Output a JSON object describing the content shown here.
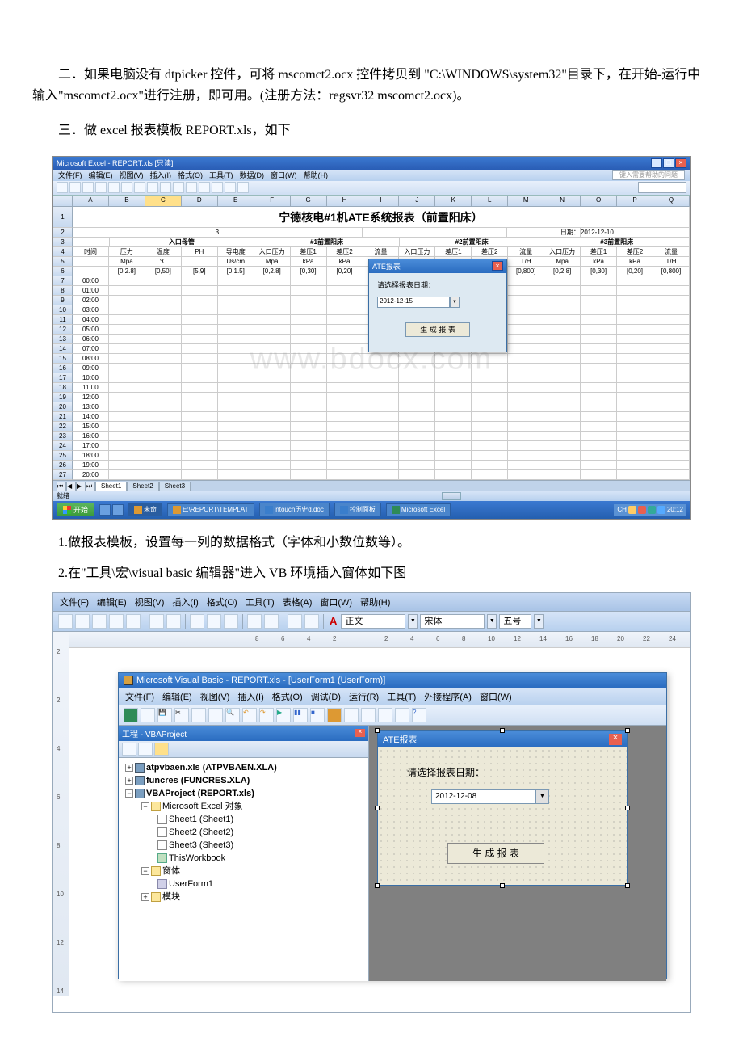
{
  "doc": {
    "para2": "二．如果电脑没有 dtpicker 控件，可将 mscomct2.ocx 控件拷贝到 \"C:\\WINDOWS\\system32\"目录下，在开始-运行中输入\"mscomct2.ocx\"进行注册，即可用。(注册方法：regsvr32 mscomct2.ocx)。",
    "para3": "三．做 excel 报表模板 REPORT.xls，如下",
    "note1": "1.做报表模板，设置每一列的数据格式（字体和小数位数等）。",
    "note2": "2.在\"工具\\宏\\visual basic 编辑器\"进入 VB 环境插入窗体如下图",
    "watermark": "www.bdocx.com"
  },
  "excel": {
    "title": "Microsoft Excel - REPORT.xls  [只读]",
    "menus": [
      "文件(F)",
      "编辑(E)",
      "视图(V)",
      "插入(I)",
      "格式(O)",
      "工具(T)",
      "数据(D)",
      "窗口(W)",
      "帮助(H)"
    ],
    "help_hint": "键入需要帮助的问题",
    "cols": [
      "A",
      "B",
      "C",
      "D",
      "E",
      "F",
      "G",
      "H",
      "I",
      "J",
      "K",
      "L",
      "M",
      "N",
      "O",
      "P",
      "Q"
    ],
    "report_title": "宁德核电#1机ATE系统报表（前置阳床）",
    "date_lbl": "日期：",
    "date_val": "2012-12-10",
    "groups": {
      "g0": "入口母管",
      "g1": "#1前置阳床",
      "g2": "#2前置阳床",
      "g3": "#3前置阳床"
    },
    "row4": [
      "时间",
      "压力",
      "温度",
      "PH",
      "导电度",
      "入口压力",
      "差压1",
      "差压2",
      "流量",
      "入口压力",
      "差压1",
      "差压2",
      "流量",
      "入口压力",
      "差压1",
      "差压2",
      "流量"
    ],
    "row5": [
      "",
      "Mpa",
      "℃",
      "",
      "Us/cm",
      "Mpa",
      "kPa",
      "kPa",
      "T/H",
      "Mpa",
      "kPa",
      "kPa",
      "T/H",
      "Mpa",
      "kPa",
      "kPa",
      "T/H"
    ],
    "row6": [
      "",
      "[0,2.8]",
      "[0,50]",
      "[5,9]",
      "[0,1.5]",
      "[0,2.8]",
      "[0,30]",
      "[0,20]",
      "[0,800]",
      "[0,2.8]",
      "[0,30]",
      "[0,20]",
      "[0,800]",
      "[0,2.8]",
      "[0,30]",
      "[0,20]",
      "[0,800]"
    ],
    "times": [
      "00:00",
      "01:00",
      "02:00",
      "03:00",
      "04:00",
      "05:00",
      "06:00",
      "07:00",
      "08:00",
      "09:00",
      "10:00",
      "11:00",
      "12:00",
      "13:00",
      "14:00",
      "15:00",
      "16:00",
      "17:00",
      "18:00",
      "19:00",
      "20:00"
    ],
    "popup": {
      "title": "ATE报表",
      "label": "请选择报表日期：",
      "date": "2012-12-15",
      "button": "生 成 报 表"
    },
    "sheets": [
      "Sheet1",
      "Sheet2",
      "Sheet3"
    ],
    "status": "就绪"
  },
  "taskbar": {
    "start": "开始",
    "tasks": [
      "未命",
      "E:\\REPORT\\TEMPLAT",
      "intouch历史d.doc",
      "控制面板",
      "Microsoft Excel"
    ],
    "tray": "CH",
    "clock": "20:12"
  },
  "word": {
    "menus": [
      "文件(F)",
      "编辑(E)",
      "视图(V)",
      "插入(I)",
      "格式(O)",
      "工具(T)",
      "表格(A)",
      "窗口(W)",
      "帮助(H)"
    ],
    "style": "正文",
    "font": "宋体",
    "size": "五号",
    "hruler": [
      "8",
      "6",
      "4",
      "2",
      "2",
      "4",
      "6",
      "8",
      "10",
      "12",
      "14",
      "16",
      "18",
      "20",
      "22",
      "24"
    ],
    "vruler": [
      "2",
      "2",
      "4",
      "6",
      "8",
      "10",
      "12",
      "14"
    ]
  },
  "vbe": {
    "title": "Microsoft Visual Basic - REPORT.xls - [UserForm1 (UserForm)]",
    "menus": [
      "文件(F)",
      "编辑(E)",
      "视图(V)",
      "插入(I)",
      "格式(O)",
      "调试(D)",
      "运行(R)",
      "工具(T)",
      "外接程序(A)",
      "窗口(W)"
    ],
    "project_pane": "工程 - VBAProject",
    "tree": {
      "atpvbaen": "atpvbaen.xls (ATPVBAEN.XLA)",
      "funcres": "funcres (FUNCRES.XLA)",
      "vbaproj": "VBAProject (REPORT.xls)",
      "msexcel": "Microsoft Excel 对象",
      "s1": "Sheet1 (Sheet1)",
      "s2": "Sheet2 (Sheet2)",
      "s3": "Sheet3 (Sheet3)",
      "twb": "ThisWorkbook",
      "forms": "窗体",
      "uf1": "UserForm1",
      "modules": "模块"
    },
    "form": {
      "title": "ATE报表",
      "label": "请选择报表日期：",
      "date": "2012-12-08",
      "button": "生 成 报 表"
    }
  }
}
